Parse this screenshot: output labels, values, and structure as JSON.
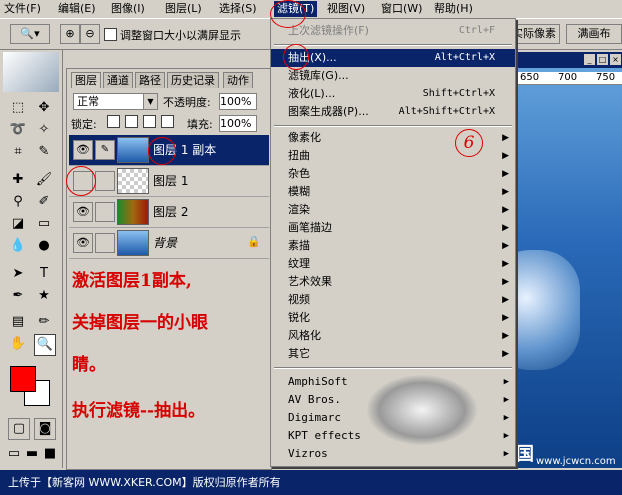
{
  "menubar": {
    "items": [
      {
        "label": "文件(F)",
        "name": "file"
      },
      {
        "label": "编辑(E)",
        "name": "edit"
      },
      {
        "label": "图像(I)",
        "name": "image"
      },
      {
        "label": "图层(L)",
        "name": "layer"
      },
      {
        "label": "选择(S)",
        "name": "select"
      },
      {
        "label": "滤镜(T)",
        "name": "filter"
      },
      {
        "label": "视图(V)",
        "name": "view"
      },
      {
        "label": "窗口(W)",
        "name": "window"
      },
      {
        "label": "帮助(H)",
        "name": "help"
      }
    ]
  },
  "options": {
    "checkbox_label": "调整窗口大小以满屏显示",
    "actual_pixels": "实际像素",
    "fit_screen": "满画布"
  },
  "layers_panel": {
    "tabs": [
      "图层",
      "通道",
      "路径",
      "历史记录",
      "动作"
    ],
    "blend_mode": "正常",
    "opacity_label": "不透明度:",
    "opacity_value": "100%",
    "lock_label": "锁定:",
    "fill_label": "填充:",
    "fill_value": "100%",
    "layers": [
      {
        "name": "图层 1 副本",
        "visible": true,
        "selected": true
      },
      {
        "name": "图层 1",
        "visible": false,
        "selected": false
      },
      {
        "name": "图层 2",
        "visible": true,
        "selected": false
      },
      {
        "name": "背景",
        "visible": true,
        "selected": false
      }
    ]
  },
  "notes": [
    "激活图层1副本,",
    "关掉图层一的小眼",
    "睛。",
    "执行滤镜--抽出。"
  ],
  "filter_menu": {
    "last_filter": {
      "label": "上次滤镜操作(F)",
      "shortcut": "Ctrl+F"
    },
    "group1": [
      {
        "label": "抽出(X)...",
        "shortcut": "Alt+Ctrl+X",
        "highlighted": true
      },
      {
        "label": "滤镜库(G)...",
        "shortcut": ""
      },
      {
        "label": "液化(L)...",
        "shortcut": "Shift+Ctrl+X"
      },
      {
        "label": "图案生成器(P)...",
        "shortcut": "Alt+Shift+Ctrl+X"
      }
    ],
    "group2": [
      "像素化",
      "扭曲",
      "杂色",
      "模糊",
      "渲染",
      "画笔描边",
      "素描",
      "纹理",
      "艺术效果",
      "视频",
      "锐化",
      "风格化",
      "其它"
    ],
    "group3": [
      "AmphiSoft",
      "AV Bros.",
      "Digimarc",
      "KPT effects",
      "Vizros"
    ],
    "step_number": "6"
  },
  "ruler": {
    "ticks": [
      "650",
      "700",
      "750"
    ]
  },
  "statusbar": {
    "text": "上传于【新客网 WWW.XKER.COM】版权归原作者所有"
  },
  "watermarks": {
    "logo_text": "中国",
    "site": "www.jcwcn.com"
  },
  "colors": {
    "accent": "#0a246a",
    "note_red": "#d60000",
    "foreground": "#ff0000",
    "background": "#ffffff"
  }
}
